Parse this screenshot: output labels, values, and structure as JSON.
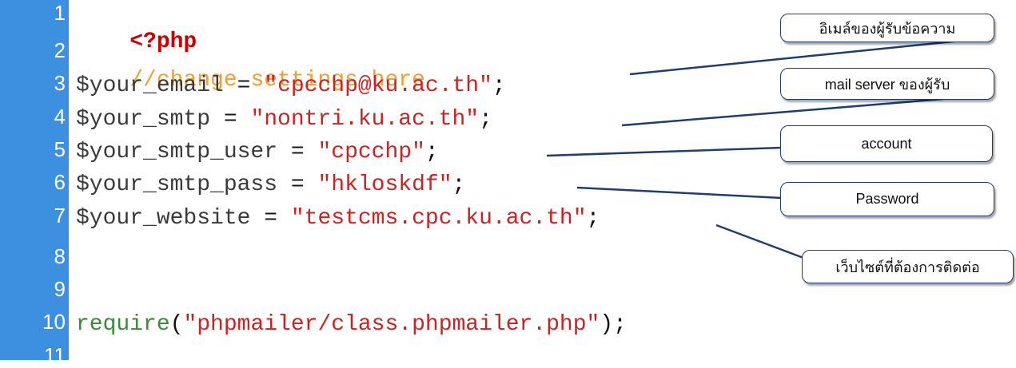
{
  "line_numbers": [
    "1",
    "2",
    "3",
    "4",
    "5",
    "6",
    "7",
    "8",
    "9",
    "10",
    "11"
  ],
  "code": {
    "line1": {
      "tag": "<?php"
    },
    "line2": {
      "comment": "//change settings here"
    },
    "line3": {
      "var": "$your_email",
      "op": " = ",
      "str": "\"cpcchp@ku.ac.th\"",
      "punct": ";"
    },
    "line4": {
      "var": "$your_smtp",
      "op": " = ",
      "str": "\"nontri.ku.ac.th\"",
      "punct": ";"
    },
    "line5": {
      "var": "$your_smtp_user",
      "op": " = ",
      "str": "\"cpcchp\"",
      "punct": ";"
    },
    "line6": {
      "var": "$your_smtp_pass",
      "op": " = ",
      "str": "\"hkloskdf\"",
      "punct": ";"
    },
    "line7": {
      "var": "$your_website",
      "op": " = ",
      "str": "\"testcms.cpc.ku.ac.th\"",
      "punct": ";"
    },
    "line10": {
      "func": "require",
      "open": "(",
      "str": "\"phpmailer/class.phpmailer.php\"",
      "close": ");"
    }
  },
  "callouts": {
    "email": "อิเมล์ของผู้รับข้อความ",
    "smtp": "mail server ของผู้รับ",
    "account": "account",
    "password": "Password",
    "website": "เว็บไซต์ที่ต้องการติดต่อ"
  },
  "colors": {
    "gutter": "#3d8fe0",
    "keyword": "#cc0000",
    "comment": "#f0a030",
    "string": "#cc2222",
    "function": "#3a8a3a",
    "callout_border": "#1f3d70"
  }
}
